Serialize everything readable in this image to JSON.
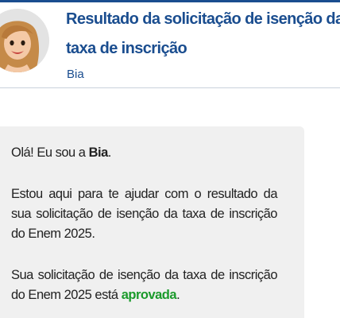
{
  "header": {
    "title": "Resultado da solicitação de isenção da taxa de inscrição",
    "subtitle": "Bia"
  },
  "messages": {
    "greeting_prefix": "Olá! Eu sou a ",
    "greeting_name": "Bia",
    "greeting_suffix": ".",
    "help": "Estou aqui para te ajudar com o resultado da sua solicitação de isenção da taxa de inscrição do Enem 2025.",
    "result_prefix": "Sua solicitação de isenção da taxa de inscrição do Enem 2025 está ",
    "result_status": "aprovada",
    "result_suffix": "."
  },
  "colors": {
    "brand": "#1a4d8f",
    "approved": "#1a9a2b",
    "bubble": "#f0f0f0"
  },
  "icons": {
    "avatar": "assistant-avatar-icon"
  }
}
